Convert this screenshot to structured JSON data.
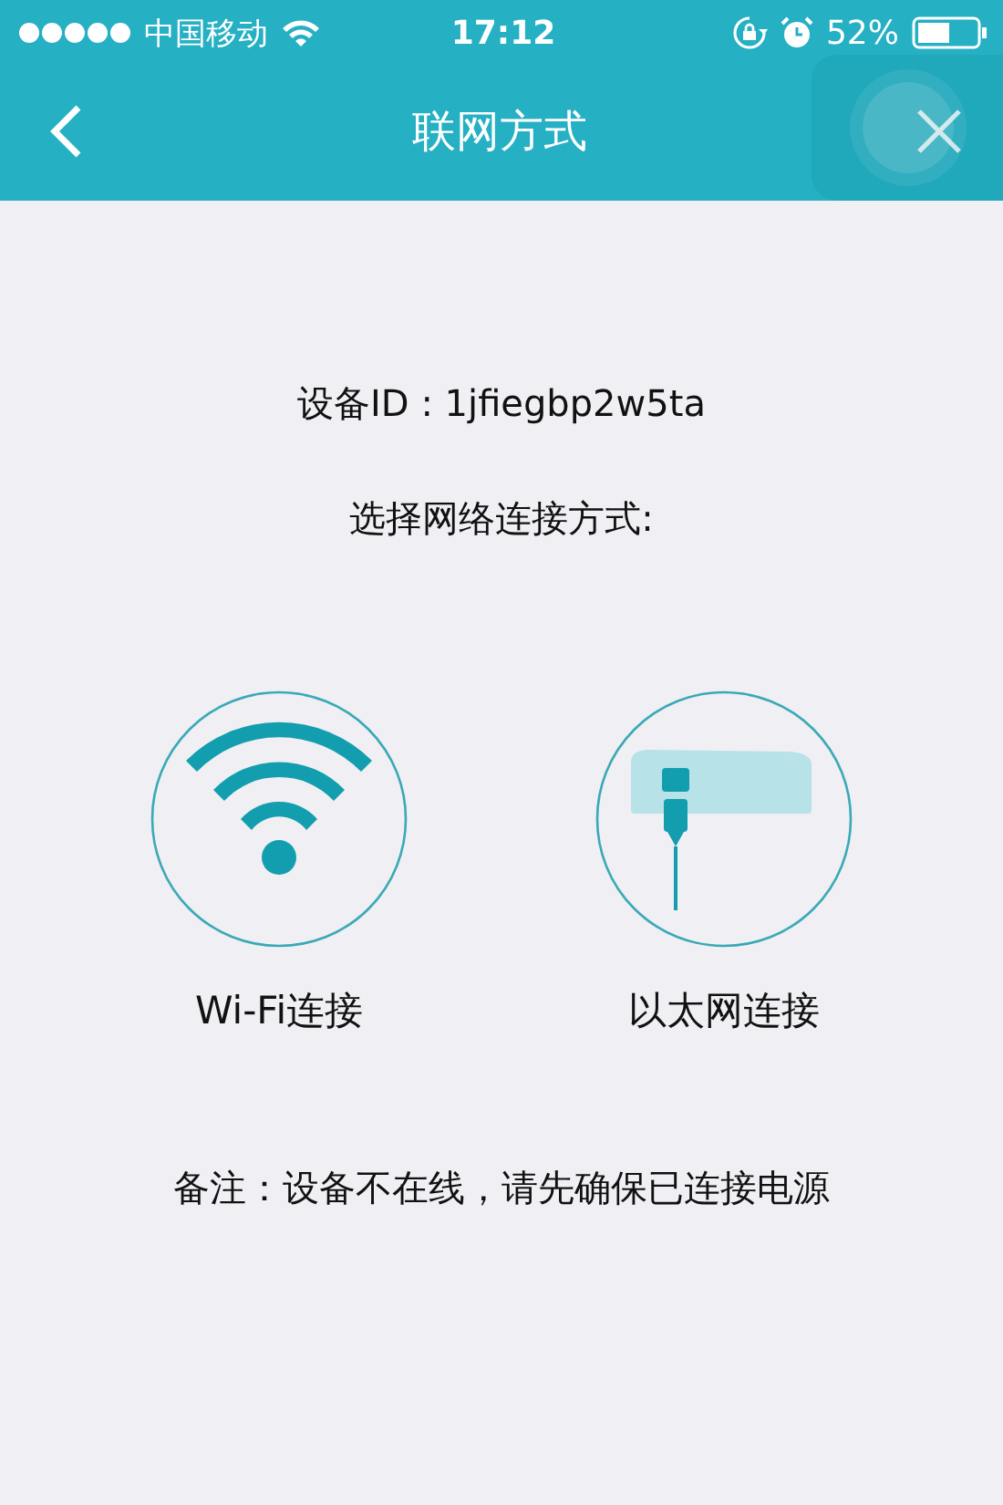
{
  "status_bar": {
    "carrier": "中国移动",
    "time": "17:12",
    "battery": "52%"
  },
  "nav": {
    "title": "联网方式"
  },
  "device_id": "设备ID : 1jfiegbp2w5ta",
  "prompt": "选择网络连接方式:",
  "options": [
    {
      "kind": "wifi",
      "label": "Wi-Fi连接"
    },
    {
      "kind": "ethernet",
      "label": "以太网连接"
    }
  ],
  "note": "备注：设备不在线，请先确保已连接电源"
}
